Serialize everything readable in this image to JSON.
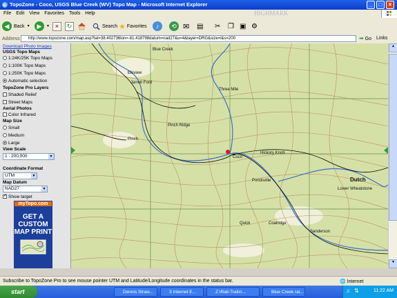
{
  "window": {
    "title": "TopoZone - Coco, USGS Blue Creek (WV) Topo Map - Microsoft Internet Explorer"
  },
  "menu": [
    "File",
    "Edit",
    "View",
    "Favorites",
    "Tools",
    "Help"
  ],
  "brand": "HIGHMARK",
  "toolbar": {
    "back": "Back",
    "search": "Search",
    "favorites": "Favorites"
  },
  "address": {
    "label": "Address",
    "url": "http://www.topozone.com/map.asp?lat=38.402736lon=-81.418798datum=nad27&u=4&layer=DRG&size=l&s=200",
    "go": "Go",
    "links": "Links"
  },
  "sidebar": {
    "download": "Download Photo Images",
    "usgs_header": "USGS Topo Maps",
    "usgs_options": [
      "1:24K/25K Topo Maps",
      "1:100K Topo Maps",
      "1:250K Topo Maps",
      "Automatic selection"
    ],
    "pro_header": "TopoZone Pro Layers",
    "pro_options": [
      "Shaded Relief",
      "Street Maps"
    ],
    "aerial_header": "Aerial Photos",
    "aerial_option": "Color Infrared",
    "size_header": "Map Size",
    "size_options": [
      "Small",
      "Medium",
      "Large"
    ],
    "scale_header": "View Scale",
    "scale_value": "1 : 200,000",
    "coord_header": "Coordinate Format",
    "coord_value": "UTM",
    "datum_header": "Map Datum",
    "datum_value": "NAD27",
    "show_target": "Show target",
    "ad_logo": "myTopo.com",
    "ad_text": [
      "GET A",
      "CUSTOM",
      "MAP PRINT"
    ]
  },
  "map": {
    "labels": [
      "Blue Creek",
      "Elkview",
      "Jarrett Ford",
      "Three Mile",
      "Pinch",
      "Pinch Ridge",
      "Coco",
      "Hickory Knob",
      "Dutch",
      "Quick",
      "Coalridge",
      "Pondsville",
      "Sanderson",
      "Lower Wheatstone"
    ]
  },
  "status": {
    "message": "Subscribe to TopoZone Pro to see mouse pointer UTM and Latitude/Longitude coordinates in the status bar.",
    "zone": "Internet"
  },
  "taskbar": {
    "start": "start",
    "tasks": [
      "Dennis Straw...",
      "3 Internet E...",
      "Z:\\Rail-Trails\\...",
      "Blue Creek rai..."
    ],
    "clock": "11:22 AM"
  },
  "colors": {
    "titlebar": "#0a3fc8",
    "map_bg": "#d5e0a6",
    "contour": "#b8895a",
    "water": "#3a6fd0",
    "road": "#000000",
    "target": "#e0141c"
  }
}
